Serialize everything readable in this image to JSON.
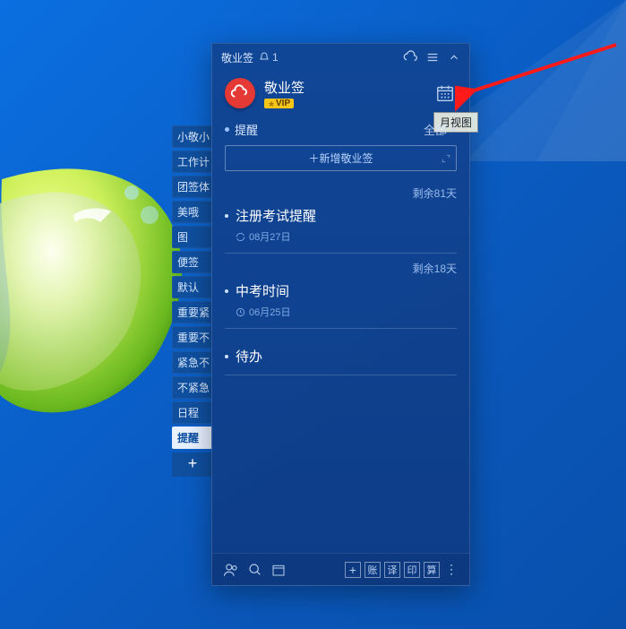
{
  "titlebar": {
    "app_name": "敬业签",
    "notification_count": "1"
  },
  "brand": {
    "name": "敬业签",
    "vip_label": "VIP"
  },
  "calendar_tooltip": "月视图",
  "section": {
    "label": "提醒",
    "filter": "全部"
  },
  "add_button": "＋新增敬业签",
  "items": [
    {
      "remaining": "剩余81天",
      "title": "注册考试提醒",
      "date": "08月27日",
      "icon": "repeat"
    },
    {
      "remaining": "剩余18天",
      "title": "中考时间",
      "date": "06月25日",
      "icon": "clock"
    },
    {
      "title": "待办"
    }
  ],
  "sidebar": {
    "tags": [
      "小敬小",
      "工作计",
      "团签体",
      "美哦",
      "图",
      "便签",
      "默认",
      "重要紧",
      "重要不",
      "紧急不",
      "不紧急",
      "日程",
      "提醒"
    ],
    "active_index": 12
  },
  "footer_right": [
    "账",
    "译",
    "印",
    "算"
  ]
}
